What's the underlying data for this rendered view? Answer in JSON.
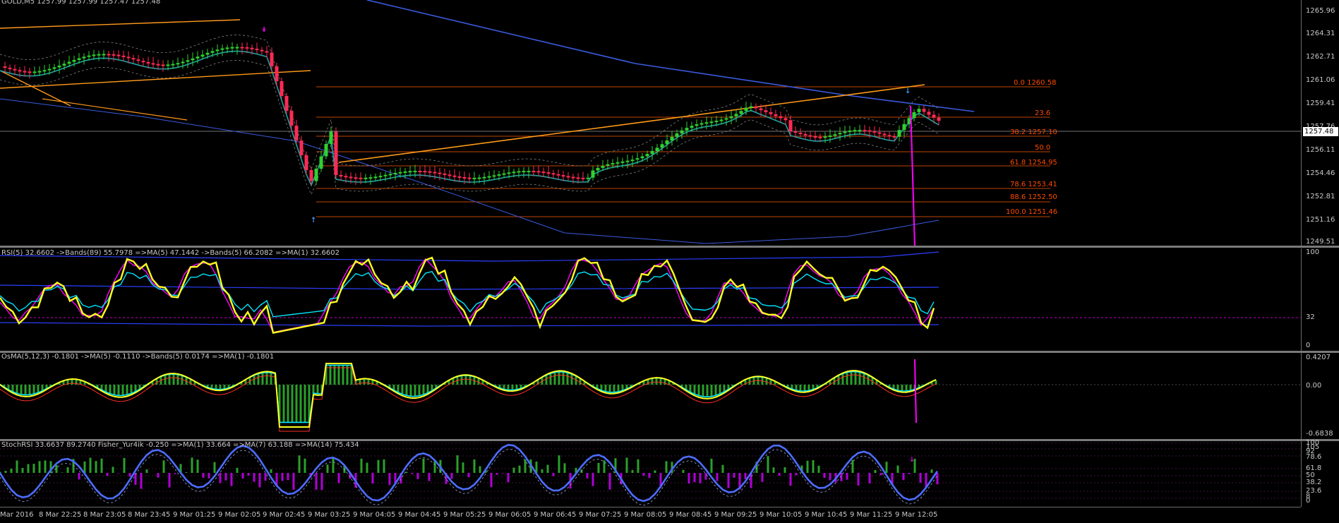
{
  "main": {
    "title": "GOLD,M5  1257.99 1257.99 1257.47 1257.48",
    "price_ticks": [
      "1265.96",
      "1264.31",
      "1262.71",
      "1261.06",
      "1259.41",
      "1257.76",
      "1256.11",
      "1254.46",
      "1252.81",
      "1251.16",
      "1249.51"
    ],
    "current_price": "1257.48",
    "fib_levels": [
      {
        "label": "0.0 1260.58"
      },
      {
        "label": "23.6"
      },
      {
        "label": "38.2 1257.10"
      },
      {
        "label": "50.0"
      },
      {
        "label": "61.8 1254.95"
      },
      {
        "label": "78.6 1253.41"
      },
      {
        "label": "88.6 1252.50"
      },
      {
        "label": "100.0 1251.46"
      }
    ]
  },
  "rsi_pane": {
    "label": "RSI(5) 32.6602  ->Bands(89) 55.7978  =>MA(5) 47.1442  ->Bands(5) 66.2082  =>MA(1) 32.6602",
    "ticks": [
      "100",
      "32",
      "0"
    ]
  },
  "osma_pane": {
    "label": "OsMA(5,12,3) -0.1801  ->MA(5) -0.1110  ->Bands(5) 0.0174  =>MA(1) -0.1801",
    "ticks": [
      "0.4207",
      "0.00",
      "-0.6838"
    ]
  },
  "stoch_pane": {
    "label": "StochRSI 33.6637 89.2740  Fisher_Yur4ik -0.250  =>MA(1) 33.664  =>MA(7) 63.188  =>MA(14) 75.434",
    "ticks": [
      "100",
      "105",
      "92",
      "78.6",
      "61.8",
      "50",
      "38.2",
      "23.6",
      "8",
      "0"
    ]
  },
  "time_labels": [
    "Mar 2016",
    "8 Mar 22:25",
    "8 Mar 23:05",
    "8 Mar 23:45",
    "9 Mar 01:25",
    "9 Mar 02:05",
    "9 Mar 02:45",
    "9 Mar 03:25",
    "9 Mar 04:05",
    "9 Mar 04:45",
    "9 Mar 05:25",
    "9 Mar 06:05",
    "9 Mar 06:45",
    "9 Mar 07:25",
    "9 Mar 08:05",
    "9 Mar 08:45",
    "9 Mar 09:25",
    "9 Mar 10:05",
    "9 Mar 10:45",
    "9 Mar 11:25",
    "9 Mar 12:05"
  ],
  "colors": {
    "background": "#000000",
    "bull_candle": "#2fd12f",
    "bear_candle": "#ff2a55",
    "fib": "#ff5a00",
    "trend": "#ff9a1a",
    "ma_blue": "#3a5bdf",
    "ma_teal": "#1fa3a3",
    "rsi_yellow": "#ffff1e",
    "cyan": "#00e5ff",
    "magenta": "#ff00ff"
  },
  "icons": [
    "arrow-down-icon",
    "arrow-up-icon",
    "arrow-marker-icon"
  ]
}
